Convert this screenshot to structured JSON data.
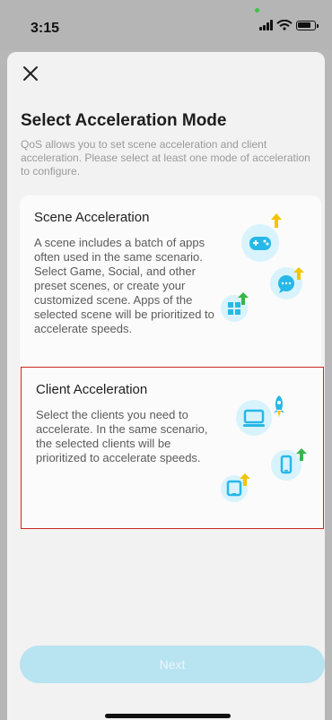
{
  "status": {
    "time": "3:15"
  },
  "screen": {
    "title": "Select Acceleration Mode",
    "subtitle": "QoS allows you to set scene acceleration and client acceleration. Please select at least one mode of acceleration to configure.",
    "cards": [
      {
        "title": "Scene Acceleration",
        "description": "A scene includes a batch of apps often used in the same scenario. Select Game, Social, and other preset scenes, or create your customized scene. Apps of the selected scene will be prioritized to accelerate speeds.",
        "selected": false
      },
      {
        "title": "Client Acceleration",
        "description": "Select the clients you need to accelerate. In the same scenario, the selected clients will be prioritized to accelerate speeds.",
        "selected": true
      }
    ],
    "next_label": "Next"
  },
  "icons": {
    "close": "close-icon",
    "game": "game-controller-icon",
    "chat": "chat-icon",
    "windows": "windows-icon",
    "laptop": "laptop-icon",
    "phone": "phone-icon",
    "tablet": "tablet-icon",
    "upload": "upload-arrow-icon",
    "rocket": "rocket-icon"
  },
  "colors": {
    "accent": "#23b7e5",
    "selected_border": "#c8281f",
    "button_disabled": "#b8e3f1",
    "icon_bg": "#d8f3fb",
    "upload_arrow": "#f2c500",
    "upload_arrow_alt": "#39b54a"
  }
}
